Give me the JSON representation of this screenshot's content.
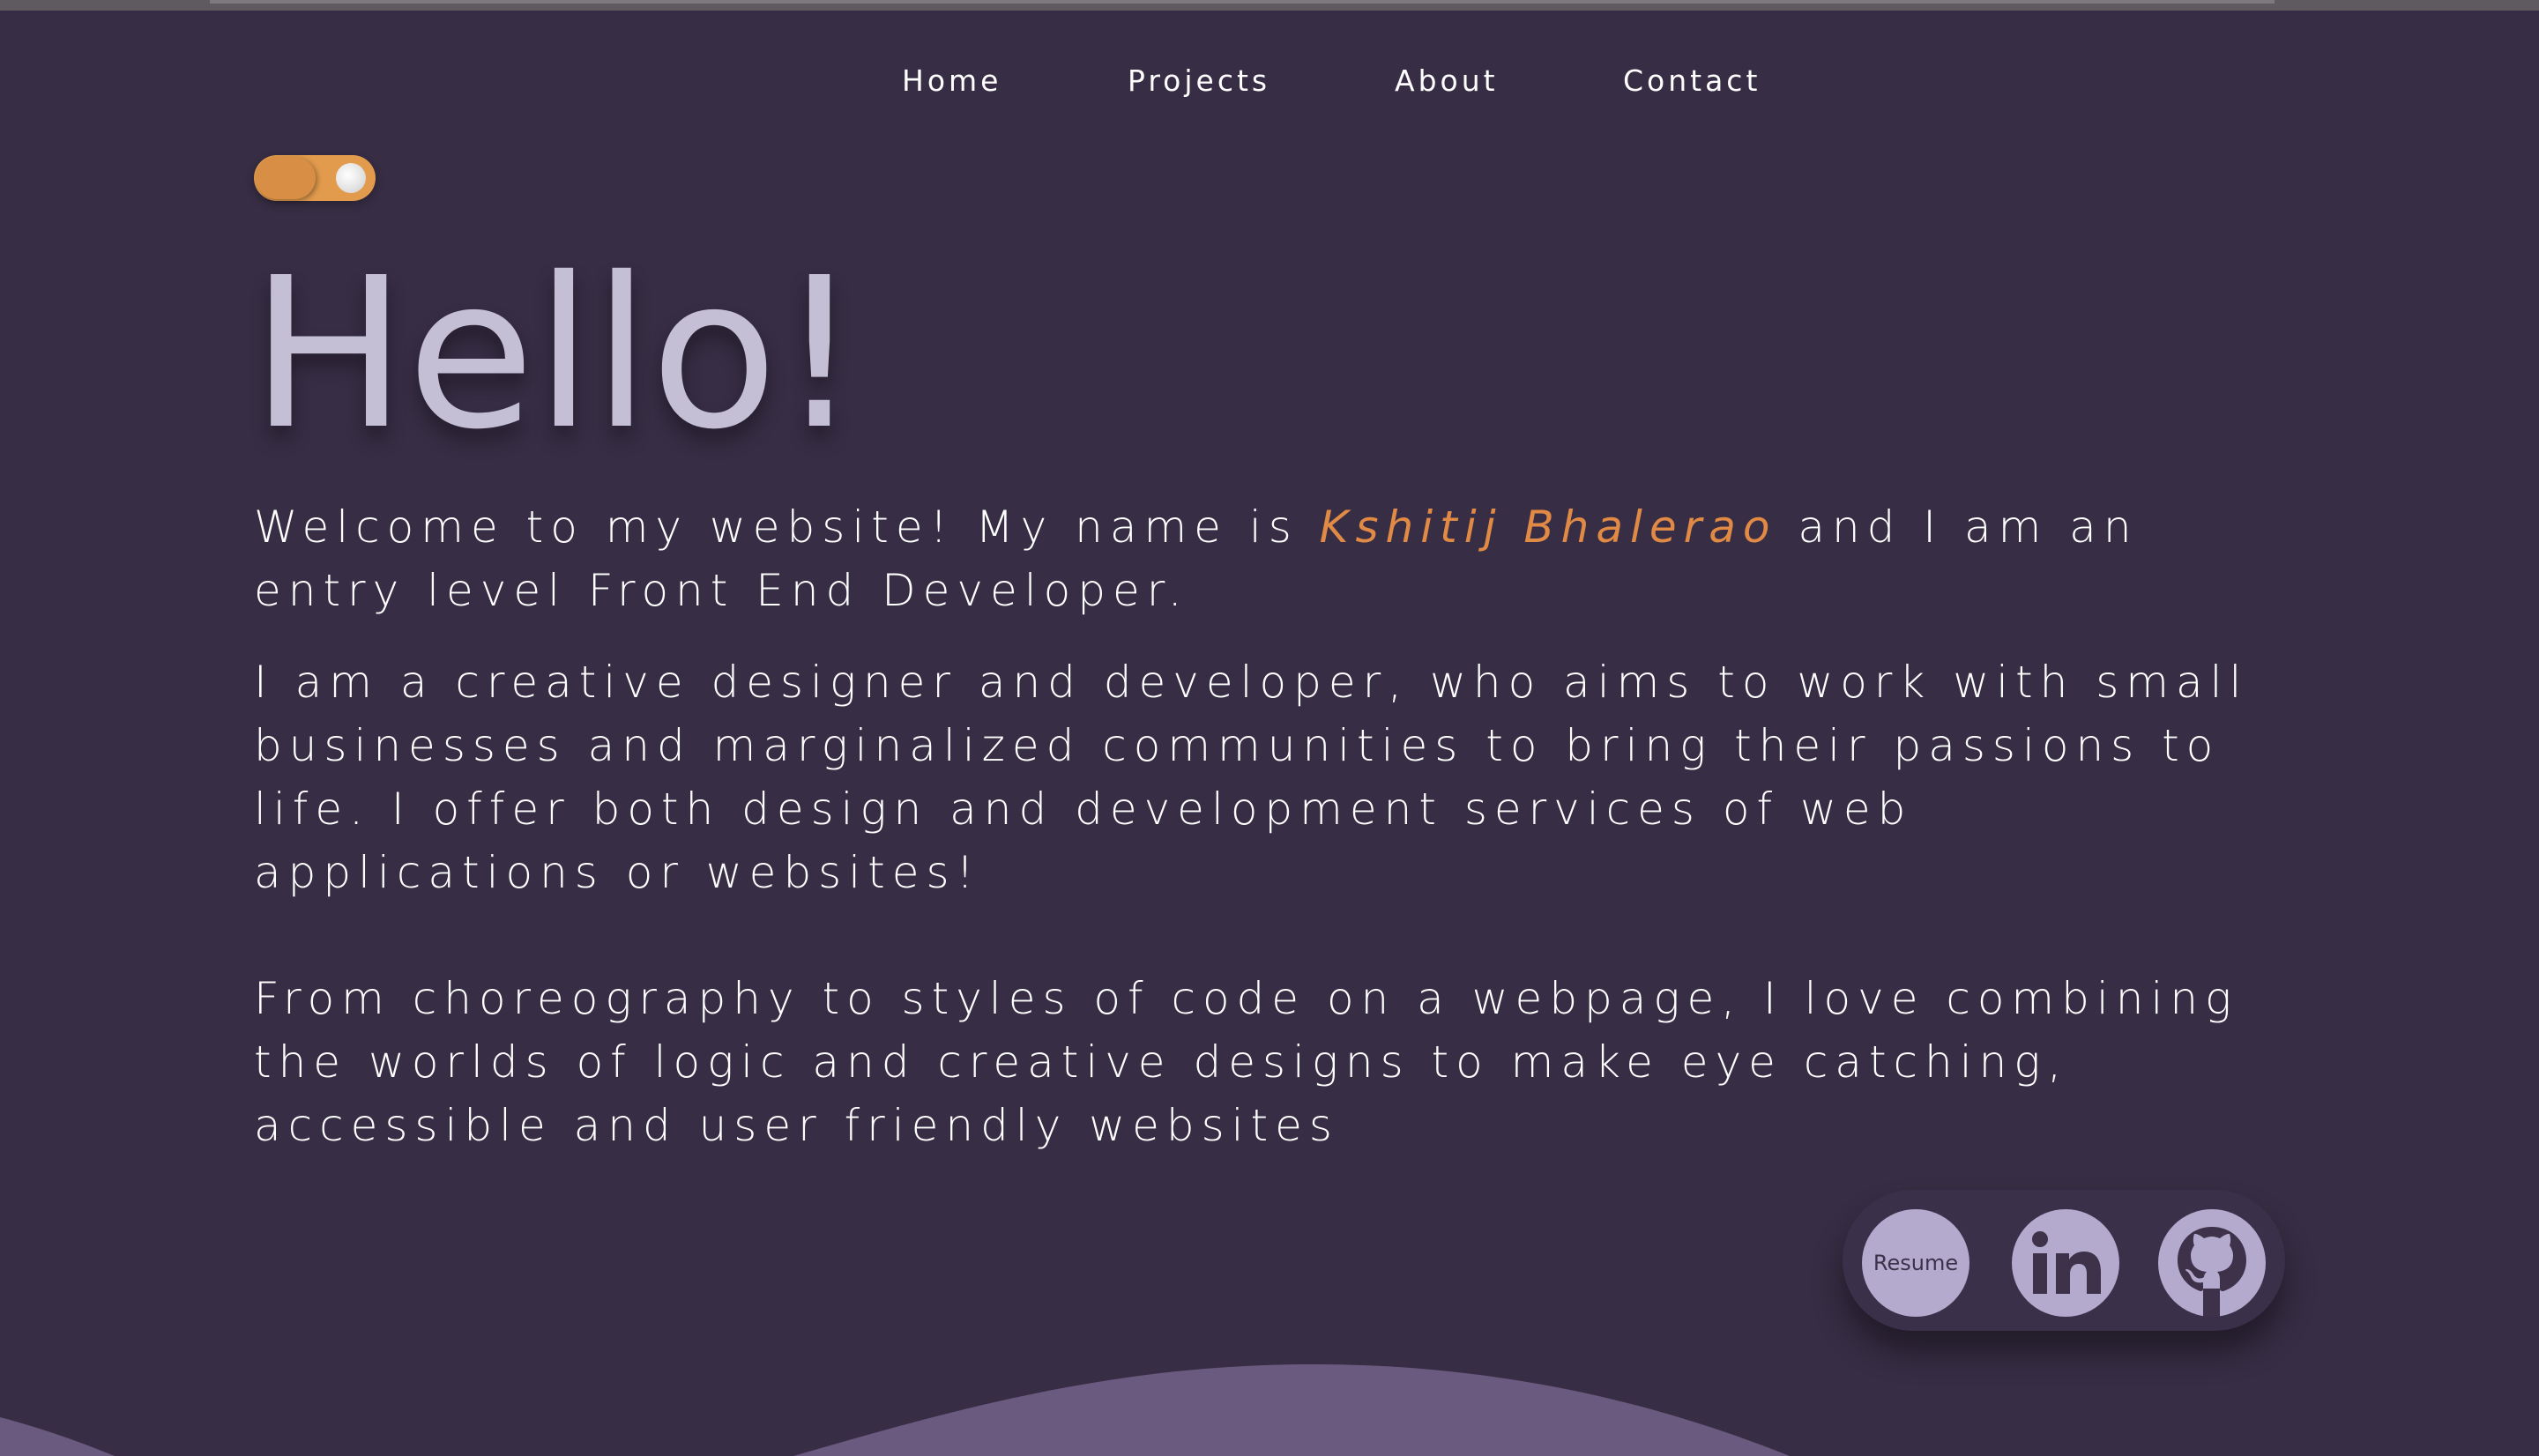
{
  "nav": {
    "items": [
      {
        "label": "Home"
      },
      {
        "label": "Projects"
      },
      {
        "label": "About"
      },
      {
        "label": "Contact"
      }
    ]
  },
  "theme_toggle": {
    "state": "dark",
    "icon": "moon-icon",
    "color": "#e29b4d"
  },
  "hero": {
    "title": "Hello!",
    "intro_before": "Welcome to my website! My name is ",
    "name": "Kshitij Bhalerao",
    "intro_after": " and I am an entry level Front End Developer.",
    "paragraph_2": "I am a creative designer and developer, who aims to work with small businesses and marginalized communities to bring their passions to life. I offer both design and development services of web applications or websites!",
    "paragraph_3": "From choreography to styles of code on a webpage, I love combining the worlds of logic and creative designs to make eye catching, accessible and user friendly websites"
  },
  "socials": {
    "resume_label": "Resume",
    "linkedin_icon": "linkedin-icon",
    "github_icon": "github-icon"
  },
  "colors": {
    "background": "#372d44",
    "accent": "#e08a45",
    "title": "#c4bfd5",
    "social_bg": "#b3aacd",
    "wave": "#6b5a80"
  }
}
